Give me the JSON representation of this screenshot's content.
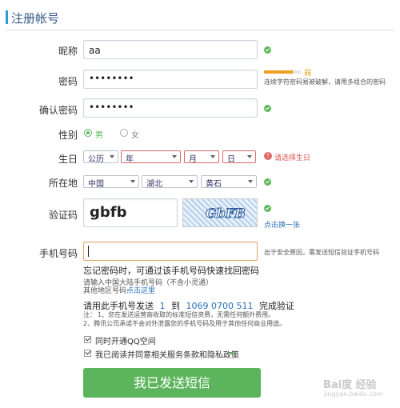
{
  "header": {
    "title": "注册帐号"
  },
  "form": {
    "nickname": {
      "label": "昵称",
      "value": "aa"
    },
    "password": {
      "label": "密码",
      "value": "••••••••",
      "strength_label": "弱",
      "strength_hint": "连续字符密码易被破解，请用多组合的密码"
    },
    "confirm": {
      "label": "确认密码",
      "value": "••••••••"
    },
    "gender": {
      "label": "性别",
      "male": "男",
      "female": "女"
    },
    "birthday": {
      "label": "生日",
      "calendar": "公历",
      "year": "年",
      "month": "月",
      "day": "日",
      "error": "请选择生日"
    },
    "location": {
      "label": "所在地",
      "country": "中国",
      "province": "湖北",
      "city": "黄石"
    },
    "captcha": {
      "label": "验证码",
      "value": "gbfb",
      "image_text": "GbFB",
      "refresh": "点击换一张"
    },
    "phone": {
      "label": "手机号码",
      "side_hint": "出于安全原因，需发送短信验证手机号码",
      "forgot_tip": "忘记密码时，可通过该手机号码快速找回密码",
      "input_tip": "请输入中国大陆手机号码（不含小灵通）",
      "other_region_prefix": "其他地区号码",
      "other_region_link": "点击这里"
    },
    "sms": {
      "instruction_prefix": "请用此手机号发送",
      "code": "1",
      "to": "到",
      "number": "1069 0700 511",
      "suffix": "完成验证",
      "note_label": "注：",
      "note1": "1、您在发送运营商收取的标准短信资费，无需任何额外费用。",
      "note2": "2、腾讯公司承诺不会对外泄露您的手机号码及用于其他任何商业用途。"
    },
    "qq_space": {
      "label": "同时开通QQ空间"
    },
    "agreement": {
      "label": "我已阅读并同意相关服务条款和隐私政策"
    },
    "submit": {
      "label": "我已发送短信"
    }
  },
  "watermark": {
    "text": "Bai度 经验",
    "url": "jingyan.baidu.com"
  },
  "colors": {
    "primary": "#5cb55c",
    "accent": "#2f9ad6",
    "error": "#e06a6a"
  }
}
